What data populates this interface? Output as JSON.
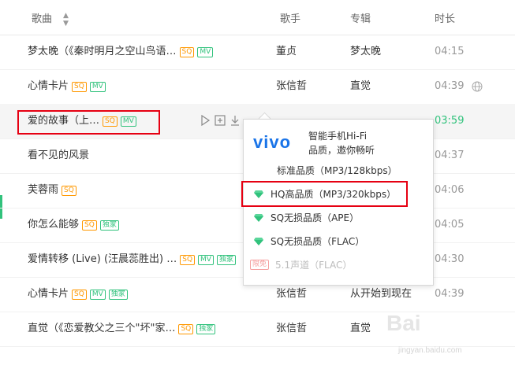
{
  "header": {
    "title_col": "歌曲",
    "artist_col": "歌手",
    "album_col": "专辑",
    "duration_col": "时长"
  },
  "rows": [
    {
      "title": "梦太晚（《秦时明月之空山鸟语…",
      "badges": [
        "SQ",
        "MV"
      ],
      "artist": "董贞",
      "album": "梦太晚",
      "duration": "04:15"
    },
    {
      "title": "心情卡片",
      "badges": [
        "SQ",
        "MV"
      ],
      "artist": "张信哲",
      "album": "直觉",
      "duration": "04:39"
    },
    {
      "title": "爱的故事（上…",
      "badges": [
        "SQ",
        "MV"
      ],
      "artist": "",
      "album": "",
      "duration": "03:59"
    },
    {
      "title": "看不见的风景",
      "badges": [],
      "artist": "",
      "album": "",
      "duration": "04:37"
    },
    {
      "title": "芙蓉雨",
      "badges": [
        "SQ"
      ],
      "artist": "",
      "album": "",
      "duration": "04:06"
    },
    {
      "title": "你怎么能够",
      "badges": [
        "SQ",
        "独家"
      ],
      "artist": "",
      "album": "",
      "duration": "04:05"
    },
    {
      "title": "爱情转移 (Live) (汪晨蕊胜出) …",
      "badges": [
        "SQ",
        "MV",
        "独家"
      ],
      "artist": "",
      "album": "",
      "duration": "04:30"
    },
    {
      "title": "心情卡片",
      "badges": [
        "SQ",
        "MV",
        "独家"
      ],
      "artist": "张信哲",
      "album": "从开始到现在",
      "duration": "04:39"
    },
    {
      "title": "直觉（《恋爱教父之三个\"坏\"家…",
      "badges": [
        "SQ",
        "独家"
      ],
      "artist": "张信哲",
      "album": "直觉",
      "duration": ""
    }
  ],
  "popup": {
    "brand": "vivo",
    "promo_line1": "智能手机Hi-Fi",
    "promo_line2": "品质，邀你畅听",
    "options": [
      {
        "label": "标准品质（MP3/128kbps）"
      },
      {
        "label": "HQ高品质（MP3/320kbps）"
      },
      {
        "label": "SQ无损品质（APE）"
      },
      {
        "label": "SQ无损品质（FLAC）"
      },
      {
        "label": "5.1声道（FLAC）",
        "tag": "限免"
      }
    ]
  },
  "watermark": {
    "main": "Bai",
    "sub": "jingyan.baidu.com"
  },
  "colors": {
    "accent": "#31c27c",
    "sq": "#ff9800",
    "highlight": "#e60012",
    "vivo": "#1a74e8"
  }
}
